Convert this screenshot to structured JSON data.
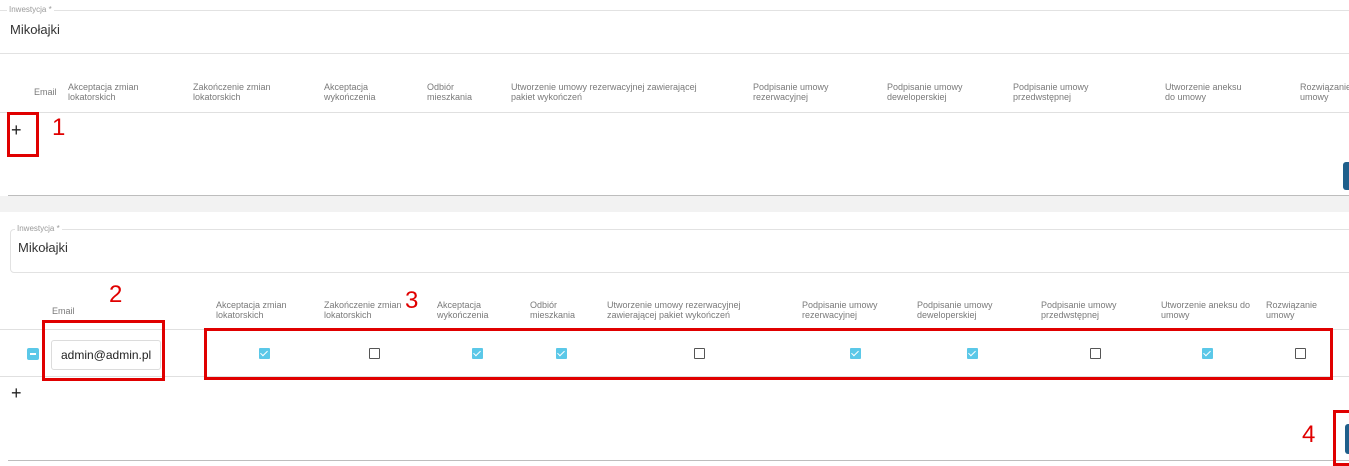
{
  "top": {
    "field_label": "Inwestycja *",
    "field_value": "Mikołajki",
    "columns": [
      "Email",
      "Akceptacja zmian lokatorskich",
      "Zakończenie zmian lokatorskich",
      "Akceptacja wykończenia",
      "Odbiór mieszkania",
      "Utworzenie umowy rezerwacyjnej zawierającej pakiet wykończeń",
      "Podpisanie umowy rezerwacyjnej",
      "Podpisanie umowy deweloperskiej",
      "Podpisanie umowy przedwstępnej",
      "Utworzenie aneksu do umowy",
      "Rozwiązanie umowy"
    ],
    "add_label": "+"
  },
  "bottom": {
    "field_label": "Inwestycja *",
    "field_value": "Mikołajki",
    "columns": [
      "Email",
      "Akceptacja zmian lokatorskich",
      "Zakończenie zmian lokatorskich",
      "Akceptacja wykończenia",
      "Odbiór mieszkania",
      "Utworzenie umowy rezerwacyjnej zawierającej pakiet wykończeń",
      "Podpisanie umowy rezerwacyjnej",
      "Podpisanie umowy deweloperskiej",
      "Podpisanie umowy przedwstępnej",
      "Utworzenie aneksu do umowy",
      "Rozwiązanie umowy"
    ],
    "row": {
      "email": "admin@admin.pl",
      "checks": [
        true,
        false,
        true,
        true,
        false,
        true,
        true,
        false,
        true,
        false
      ]
    },
    "add_label": "+"
  },
  "annotations": [
    "1",
    "2",
    "3",
    "4"
  ],
  "colors": {
    "accent": "#5bc8e8",
    "button": "#1f5f8b",
    "annotation": "#e00000"
  }
}
